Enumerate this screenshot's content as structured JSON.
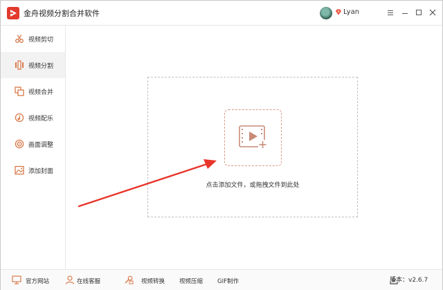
{
  "app": {
    "title": "金舟视频分割合并软件",
    "username": "Lyan",
    "accent_color": "#e23b2e",
    "highlight_color": "#d98c73"
  },
  "sidebar": {
    "items": [
      {
        "label": "视频剪切",
        "icon": "scissors-icon",
        "active": false
      },
      {
        "label": "视频分割",
        "icon": "split-icon",
        "active": true
      },
      {
        "label": "视频合并",
        "icon": "merge-icon",
        "active": false
      },
      {
        "label": "视频配乐",
        "icon": "music-icon",
        "active": false
      },
      {
        "label": "画面调整",
        "icon": "adjust-icon",
        "active": false
      },
      {
        "label": "添加封面",
        "icon": "image-icon",
        "active": false
      }
    ]
  },
  "main": {
    "drop_hint": "点击添加文件，或拖拽文件到此处"
  },
  "bottombar": {
    "website": "官方网站",
    "support": "在线客服",
    "convert": "视频转换",
    "compress": "视频压缩",
    "gif": "GIF制作",
    "version": "版本：v2.6.7"
  }
}
